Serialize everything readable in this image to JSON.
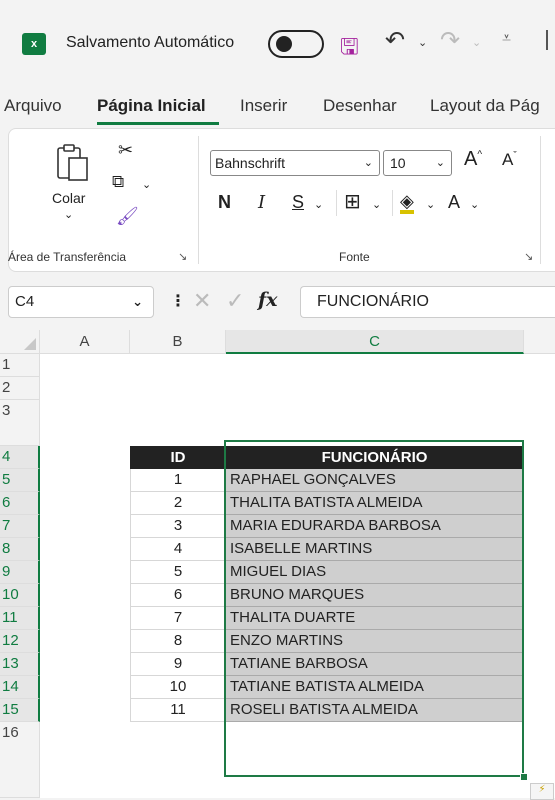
{
  "titlebar": {
    "app_icon": "excel-icon",
    "app_letter": "x",
    "autosave_label": "Salvamento Automático",
    "autosave_state": "off"
  },
  "menu": {
    "items": [
      "Arquivo",
      "Página Inicial",
      "Inserir",
      "Desenhar",
      "Layout da Pág"
    ],
    "active": "Página Inicial"
  },
  "ribbon": {
    "clipboard": {
      "paste_label": "Colar",
      "group_label": "Área de Transferência"
    },
    "font": {
      "font_name": "Bahnschrift",
      "font_size": "10",
      "grow_label": "A",
      "shrink_label": "A",
      "bold_label": "N",
      "italic_label": "I",
      "underline_label": "S",
      "font_color_label": "A",
      "group_label": "Fonte"
    }
  },
  "formula_bar": {
    "name_box": "C4",
    "fx_label": "fx",
    "content": "FUNCIONÁRIO"
  },
  "sheet": {
    "columns": [
      "A",
      "B",
      "C"
    ],
    "selected_column": "C",
    "rows": [
      "1",
      "2",
      "3",
      "4",
      "5",
      "6",
      "7",
      "8",
      "9",
      "10",
      "11",
      "12",
      "13",
      "14",
      "15",
      "16"
    ],
    "selected_rows": [
      "4",
      "5",
      "6",
      "7",
      "8",
      "9",
      "10",
      "11",
      "12",
      "13",
      "14",
      "15"
    ],
    "table_headers": {
      "id": "ID",
      "name": "FUNCIONÁRIO"
    },
    "table_rows": [
      {
        "id": "1",
        "name": "RAPHAEL GONÇALVES"
      },
      {
        "id": "2",
        "name": "THALITA BATISTA ALMEIDA"
      },
      {
        "id": "3",
        "name": "MARIA EDURARDA BARBOSA"
      },
      {
        "id": "4",
        "name": "ISABELLE MARTINS"
      },
      {
        "id": "5",
        "name": "MIGUEL DIAS"
      },
      {
        "id": "6",
        "name": "BRUNO MARQUES"
      },
      {
        "id": "7",
        "name": "THALITA DUARTE"
      },
      {
        "id": "8",
        "name": "ENZO MARTINS"
      },
      {
        "id": "9",
        "name": "TATIANE BARBOSA"
      },
      {
        "id": "10",
        "name": "TATIANE BATISTA ALMEIDA"
      },
      {
        "id": "11",
        "name": "ROSELI BATISTA ALMEIDA"
      }
    ]
  },
  "colors": {
    "accent": "#107c41",
    "header_bg": "#222222",
    "selection_fill": "#cfcfcf"
  }
}
